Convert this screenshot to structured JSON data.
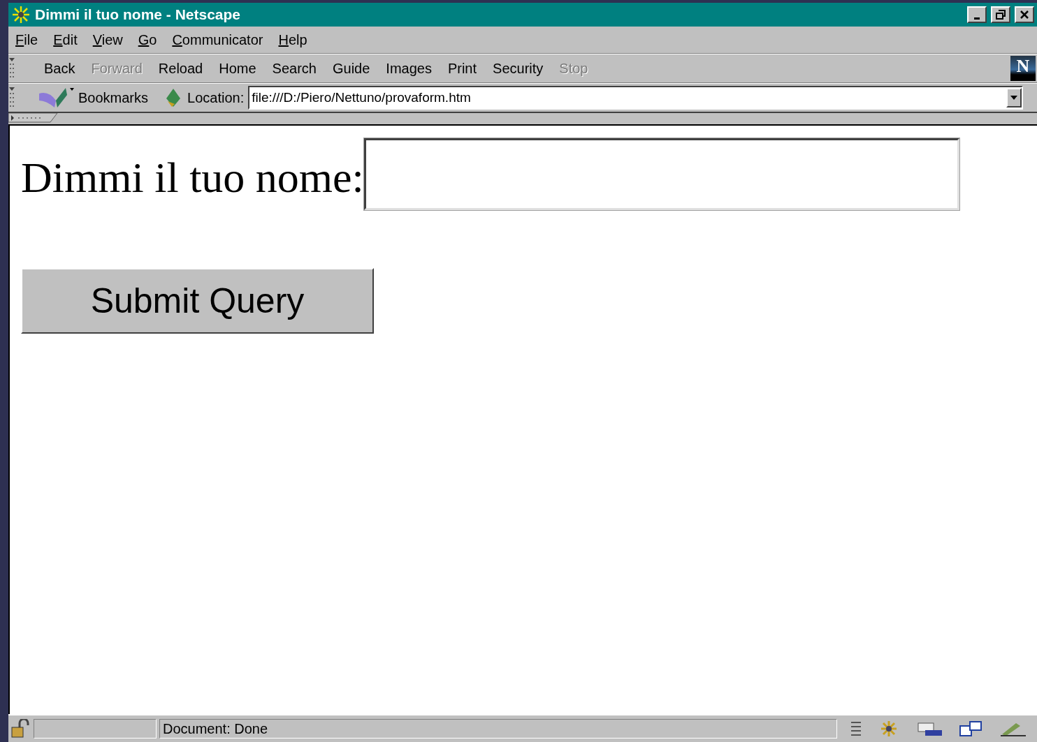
{
  "window": {
    "title": "Dimmi il tuo nome - Netscape"
  },
  "menu": [
    {
      "label": "File"
    },
    {
      "label": "Edit"
    },
    {
      "label": "View"
    },
    {
      "label": "Go"
    },
    {
      "label": "Communicator"
    },
    {
      "label": "Help"
    }
  ],
  "toolbar": [
    {
      "label": "Back",
      "disabled": false
    },
    {
      "label": "Forward",
      "disabled": true
    },
    {
      "label": "Reload",
      "disabled": false
    },
    {
      "label": "Home",
      "disabled": false
    },
    {
      "label": "Search",
      "disabled": false
    },
    {
      "label": "Guide",
      "disabled": false
    },
    {
      "label": "Images",
      "disabled": false
    },
    {
      "label": "Print",
      "disabled": false
    },
    {
      "label": "Security",
      "disabled": false
    },
    {
      "label": "Stop",
      "disabled": true
    }
  ],
  "logo": "N",
  "location_bar": {
    "bookmarks": "Bookmarks",
    "label": "Location:",
    "url": "file:///D:/Piero/Nettuno/provaform.htm"
  },
  "page": {
    "label": "Dimmi il tuo nome:",
    "button": "Submit Query"
  },
  "status_bar": {
    "text": "Document: Done"
  }
}
